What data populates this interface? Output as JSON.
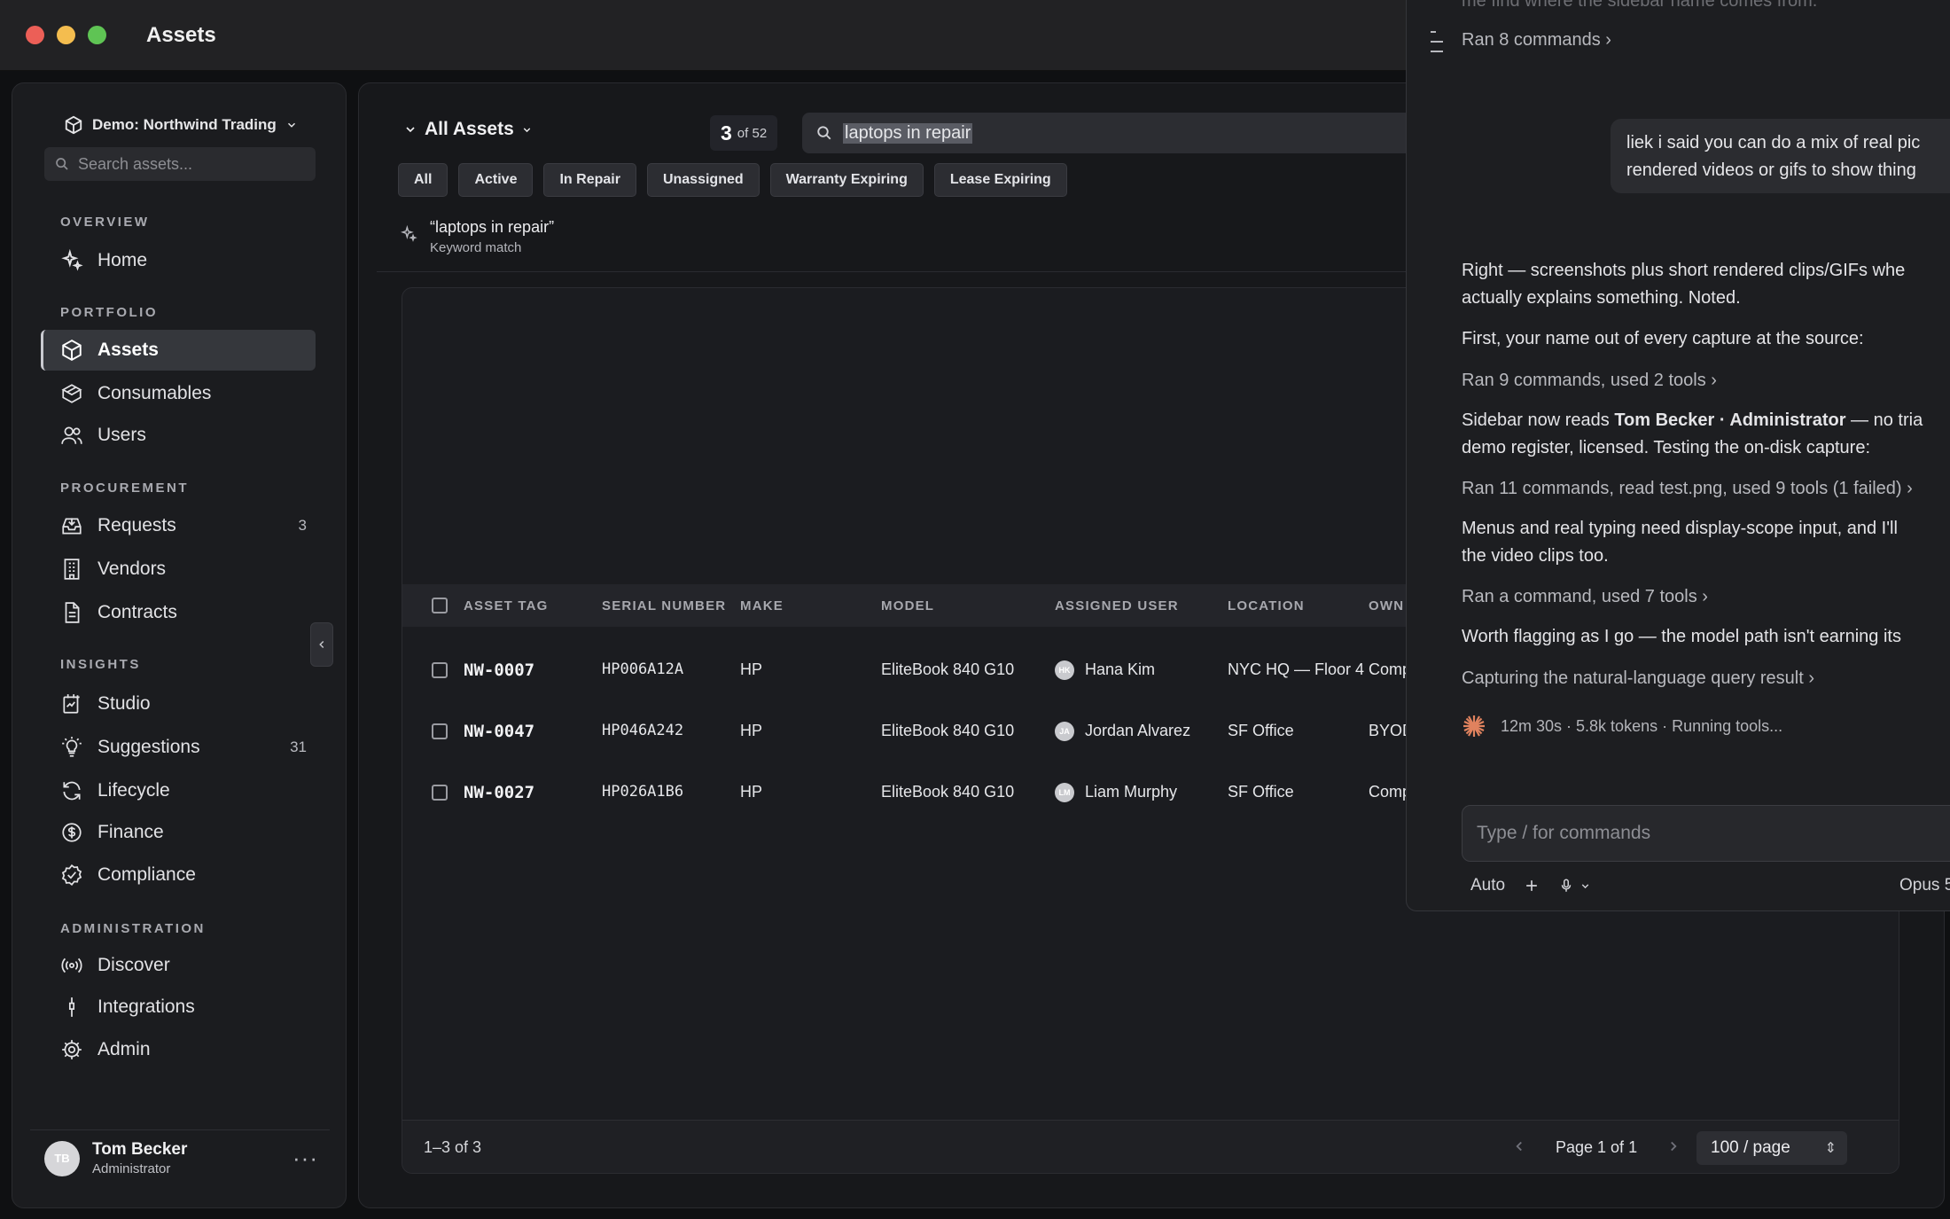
{
  "window": {
    "title": "Assets"
  },
  "sidebar": {
    "org": "Demo: Northwind Trading",
    "search_placeholder": "Search assets...",
    "sections": {
      "overview": "OVERVIEW",
      "portfolio": "PORTFOLIO",
      "procurement": "PROCUREMENT",
      "insights": "INSIGHTS",
      "administration": "ADMINISTRATION"
    },
    "items": {
      "home": "Home",
      "assets": "Assets",
      "consumables": "Consumables",
      "users": "Users",
      "requests": "Requests",
      "requests_count": "3",
      "vendors": "Vendors",
      "contracts": "Contracts",
      "studio": "Studio",
      "suggestions": "Suggestions",
      "suggestions_count": "31",
      "lifecycle": "Lifecycle",
      "finance": "Finance",
      "compliance": "Compliance",
      "discover": "Discover",
      "integrations": "Integrations",
      "admin": "Admin"
    },
    "user": {
      "initials": "TB",
      "name": "Tom Becker",
      "role": "Administrator",
      "more": "···"
    }
  },
  "main": {
    "view": "All Assets",
    "count": "3",
    "count_of": "of 52",
    "search_value": "laptops in repair",
    "chips": [
      "All",
      "Active",
      "In Repair",
      "Unassigned",
      "Warranty Expiring",
      "Lease Expiring"
    ],
    "query": {
      "text": "“laptops in repair”",
      "sub": "Keyword match"
    },
    "table": {
      "headers": [
        "ASSET TAG",
        "SERIAL NUMBER",
        "MAKE",
        "MODEL",
        "ASSIGNED USER",
        "LOCATION",
        "OWN"
      ],
      "rows": [
        {
          "tag": "NW-0007",
          "serial": "HP006A12A",
          "make": "HP",
          "model": "EliteBook 840 G10",
          "initials": "HK",
          "user": "Hana Kim",
          "location": "NYC HQ — Floor 4",
          "owner": "Comp"
        },
        {
          "tag": "NW-0047",
          "serial": "HP046A242",
          "make": "HP",
          "model": "EliteBook 840 G10",
          "initials": "JA",
          "user": "Jordan Alvarez",
          "location": "SF Office",
          "owner": "BYOD"
        },
        {
          "tag": "NW-0027",
          "serial": "HP026A1B6",
          "make": "HP",
          "model": "EliteBook 840 G10",
          "initials": "LM",
          "user": "Liam Murphy",
          "location": "SF Office",
          "owner": "Comp"
        }
      ]
    },
    "footer": {
      "range": "1–3 of 3",
      "page": "Page 1 of 1",
      "per_page": "100 / page"
    }
  },
  "chat": {
    "faded_top": "me find where the sidebar name comes from.",
    "ran1": "Ran 8 commands",
    "user_msg_1": "liek i said you can do a mix of real pic",
    "user_msg_2": "rendered videos or gifs to show thing",
    "p1_line1": "Right — screenshots plus short rendered clips/GIFs whe",
    "p1_line2": "actually explains something. Noted.",
    "p2": "First, your name out of every capture at the source:",
    "ran2": "Ran 9 commands, used 2 tools",
    "p3_pre": "Sidebar now reads ",
    "p3_bold": "Tom Becker · Administrator",
    "p3_post": " — no tria",
    "p3_line2": "demo register, licensed. Testing the on-disk capture:",
    "ran3": "Ran 11 commands, read test.png, used 9 tools (1 failed)",
    "p4_line1": "Menus and real typing need display-scope input, and I'll",
    "p4_line2": "the video clips too.",
    "ran4": "Ran a command, used 7 tools",
    "p5": "Worth flagging as I go — the model path isn't earning its",
    "ran5": "Capturing the natural-language query result",
    "status": "12m 30s · 5.8k tokens · Running tools...",
    "input_placeholder": "Type / for commands",
    "mode": "Auto",
    "model": "Opus 5"
  }
}
